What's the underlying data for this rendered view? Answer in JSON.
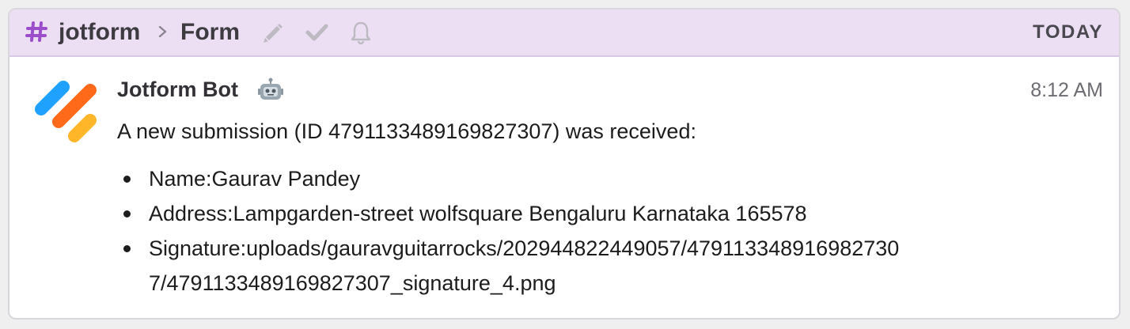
{
  "header": {
    "workspace": "jotform",
    "form": "Form",
    "date_divider": "TODAY",
    "icons": [
      "hash-icon",
      "chevron-right-icon",
      "pencil-icon",
      "check-icon",
      "bell-icon"
    ]
  },
  "message": {
    "sender": "Jotform Bot",
    "sender_badge_icon": "robot-icon",
    "time": "8:12 AM",
    "intro": "A new submission (ID 4791133489169827307) was received:",
    "fields": [
      {
        "text": "Name:Gaurav Pandey"
      },
      {
        "text": "Address:Lampgarden-street wolfsquare Bengaluru Karnataka 165578"
      },
      {
        "text": "Signature:uploads/gauravguitarrocks/202944822449057/4791133489169827307/4791133489169827307_signature_4.png"
      }
    ]
  },
  "colors": {
    "header_bg": "#ecdff4",
    "hash": "#9b4dca",
    "logo_blue": "#1fa1ff",
    "logo_orange": "#ff6a1a",
    "logo_yellow": "#ffb629"
  }
}
